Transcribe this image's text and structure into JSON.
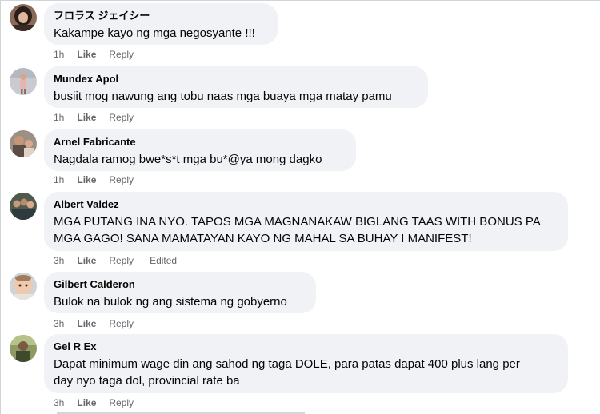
{
  "comments": [
    {
      "author": "フロラス ジェイシー",
      "text": "Kakampe kayo ng mga negosyante !!!",
      "time": "1h",
      "like": "Like",
      "reply": "Reply",
      "avatar_icon": "profile-photo-dark-hair-woman"
    },
    {
      "author": "Mundex Apol",
      "text": "busiit mog nawung ang tobu naas mga buaya mga matay pamu",
      "time": "1h",
      "like": "Like",
      "reply": "Reply",
      "avatar_icon": "profile-photo-standing-figure"
    },
    {
      "author": "Arnel Fabricante",
      "text": "Nagdala ramog bwe*s*t mga bu*@ya mong dagko",
      "time": "1h",
      "like": "Like",
      "reply": "Reply",
      "avatar_icon": "profile-photo-man-with-child"
    },
    {
      "author": "Albert Valdez",
      "text_lines": [
        "MGA PUTANG INA NYO. TAPOS MGA MAGNANAKAW BIGLANG TAAS WITH BONUS PA",
        "MGA GAGO! SANA MAMATAYAN KAYO NG MAHAL SA BUHAY I MANIFEST!"
      ],
      "time": "3h",
      "like": "Like",
      "reply": "Reply",
      "edited": "Edited",
      "avatar_icon": "profile-photo-group"
    },
    {
      "author": "Gilbert Calderon",
      "text": "Bulok na bulok ng ang sistema ng gobyerno",
      "time": "3h",
      "like": "Like",
      "reply": "Reply",
      "avatar_icon": "profile-photo-baby"
    },
    {
      "author": "Gel R Ex",
      "text_lines": [
        "Dapat minimum wage din ang sahod ng taga DOLE, para patas dapat 400 plus lang per",
        "day nyo taga dol, provincial rate ba"
      ],
      "time": "3h",
      "like": "Like",
      "reply": "Reply",
      "avatar_icon": "profile-photo-outdoor"
    }
  ],
  "colors": {
    "bubble": "#f0f2f5",
    "text": "#050505",
    "meta": "#65676b"
  }
}
